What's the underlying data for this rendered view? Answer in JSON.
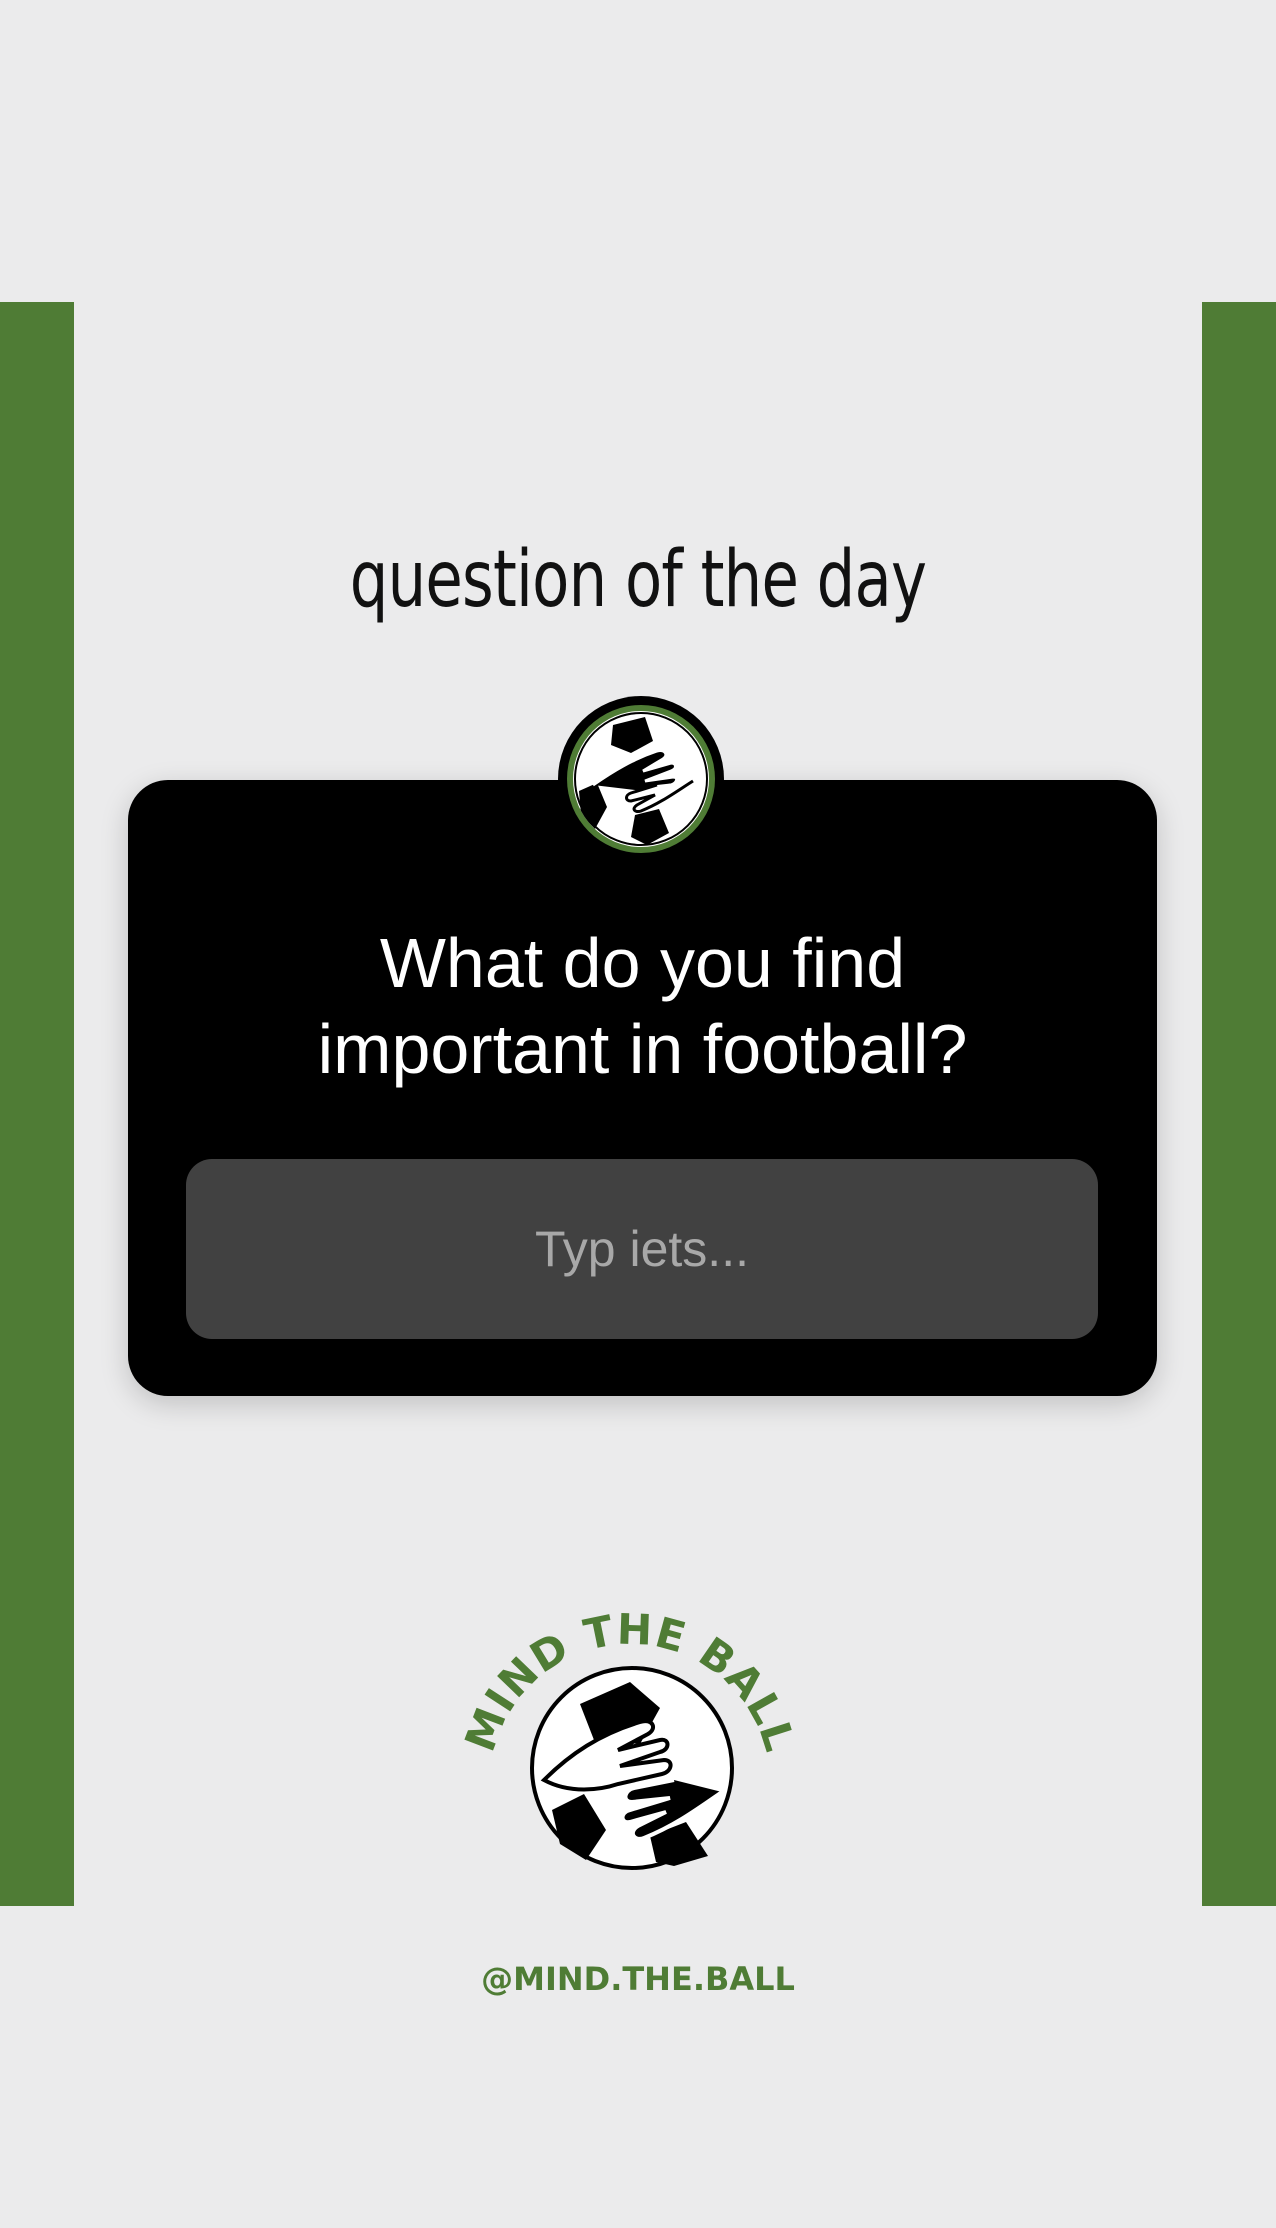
{
  "story": {
    "headline": "question of the day",
    "question_card": {
      "question": "What do you find\nimportant in football?",
      "answer_placeholder": "Typ iets..."
    },
    "logo": {
      "wordmark": "MIND THE BALL",
      "icon": "soccer-ball-hands-icon"
    },
    "handle": "@MIND.THE.BALL"
  },
  "colors": {
    "background": "#ebebec",
    "brand_green": "#4f7c35",
    "card": "#000000",
    "input": "#414141"
  }
}
